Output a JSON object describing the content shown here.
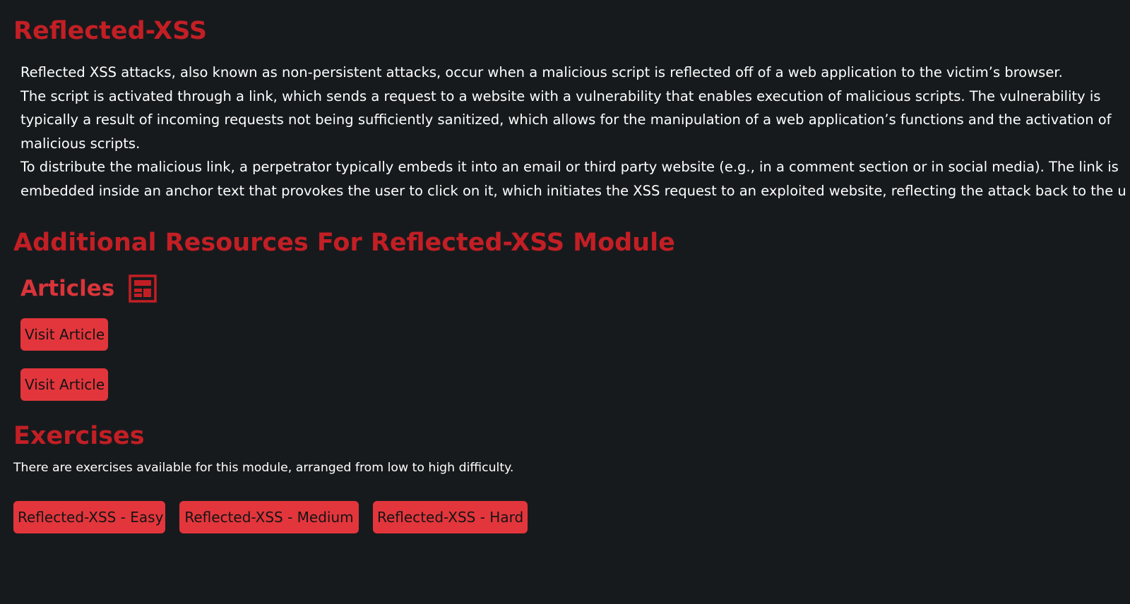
{
  "module": {
    "title": "Reflected-XSS",
    "intro_paragraphs": [
      "Reflected XSS attacks, also known as non-persistent attacks, occur when a malicious script is reflected off of a web application to the victim’s browser.",
      "The script is activated through a link, which sends a request to a website with a vulnerability that enables execution of malicious scripts. The vulnerability is",
      "typically a result of incoming requests not being sufficiently sanitized, which allows for the manipulation of a web application’s functions and the activation of",
      "malicious scripts.",
      "To distribute the malicious link, a perpetrator typically embeds it into an email or third party website (e.g., in a comment section or in social media). The link is",
      "embedded inside an anchor text that provokes the user to click on it, which initiates the XSS request to an exploited website, reflecting the attack back to the u"
    ]
  },
  "resources": {
    "title": "Additional Resources For Reflected-XSS Module",
    "articles_heading": "Articles",
    "articles_icon": "article-icon",
    "article_buttons": [
      "Visit Article",
      "Visit Article"
    ]
  },
  "exercises": {
    "title": "Exercises",
    "description": "There are exercises available for this module, arranged from low to high difficulty.",
    "buttons": [
      "Reflected-XSS - Easy",
      "Reflected-XSS - Medium",
      "Reflected-XSS - Hard"
    ]
  },
  "colors": {
    "background": "#171a1d",
    "heading": "#c21f25",
    "subheading": "#d9343a",
    "button": "#e2363c",
    "text": "#ffffff"
  }
}
